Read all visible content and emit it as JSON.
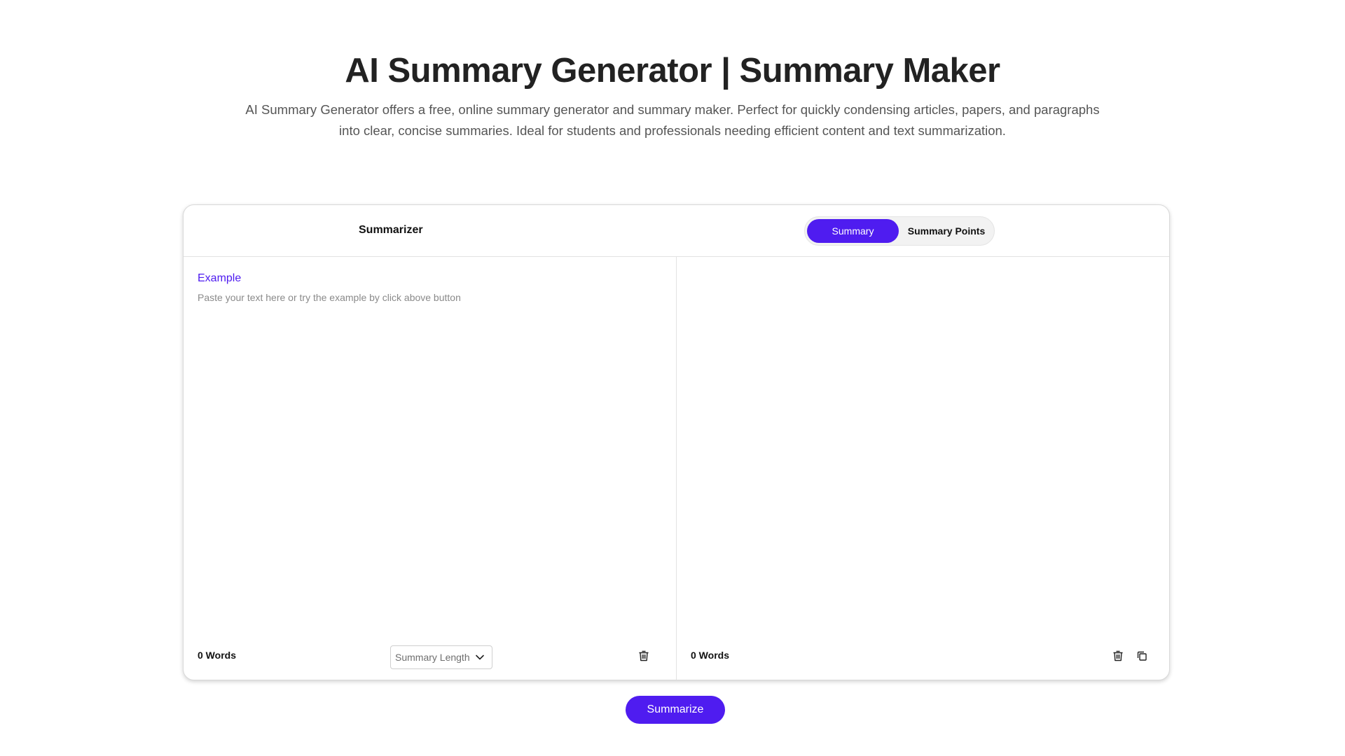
{
  "hero": {
    "title": "AI Summary Generator | Summary Maker",
    "description": "AI Summary Generator offers a free, online summary generator and summary maker. Perfect for quickly condensing articles, papers, and paragraphs into clear, concise summaries. Ideal for students and professionals needing efficient content and text summarization."
  },
  "card": {
    "header_label": "Summarizer",
    "modes": [
      {
        "label": "Summary",
        "active": true
      },
      {
        "label": "Summary Points",
        "active": false
      }
    ],
    "input_pane": {
      "example_label": "Example",
      "placeholder": "Paste your text here or try the example by click above button",
      "value": "",
      "word_count": "0 Words",
      "length_select_label": "Summary Length",
      "delete_icon": "trash-icon"
    },
    "output_pane": {
      "word_count": "0 Words",
      "delete_icon": "trash-icon",
      "copy_icon": "copy-icon"
    }
  },
  "actions": {
    "summarize_label": "Summarize"
  },
  "colors": {
    "accent": "#4f1cf0",
    "title": "#222222",
    "description": "#555555"
  }
}
